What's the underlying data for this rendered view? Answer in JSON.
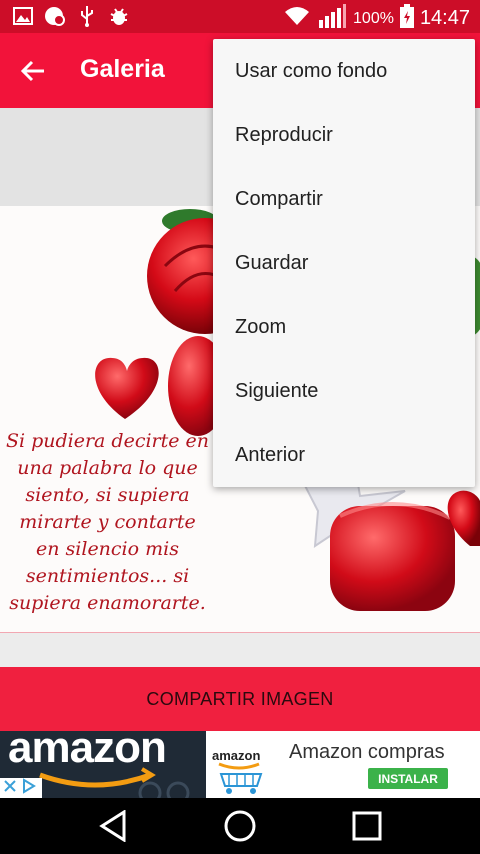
{
  "status_bar": {
    "battery_percent": "100%",
    "time": "14:47",
    "icons": [
      "gallery-icon",
      "notification-icon",
      "usb-icon",
      "debug-icon",
      "wifi-icon",
      "signal-icon",
      "battery-icon"
    ]
  },
  "app_bar": {
    "title": "Galeria",
    "back_icon": "arrow-back-icon"
  },
  "poem": {
    "lines": [
      "Si pudiera decirte en",
      "una palabra lo que",
      "siento, si supiera",
      "mirarte y contarte",
      "en silencio mis",
      "sentimientos... si",
      "supiera enamorarte."
    ]
  },
  "share_button": {
    "label": "COMPARTIR IMAGEN"
  },
  "ad": {
    "logo_text": "amazon",
    "card_text": "amazon",
    "title": "Amazon compras",
    "install_label": "INSTALAR"
  },
  "menu": {
    "items": [
      {
        "label": "Usar como fondo"
      },
      {
        "label": "Reproducir"
      },
      {
        "label": "Compartir"
      },
      {
        "label": "Guardar"
      },
      {
        "label": "Zoom"
      },
      {
        "label": "Siguiente"
      },
      {
        "label": "Anterior"
      }
    ]
  },
  "colors": {
    "status_bar": "#cc0d28",
    "app_bar": "#f2133a",
    "share_button": "#f0203f",
    "menu_bg": "#f7f7f7"
  }
}
